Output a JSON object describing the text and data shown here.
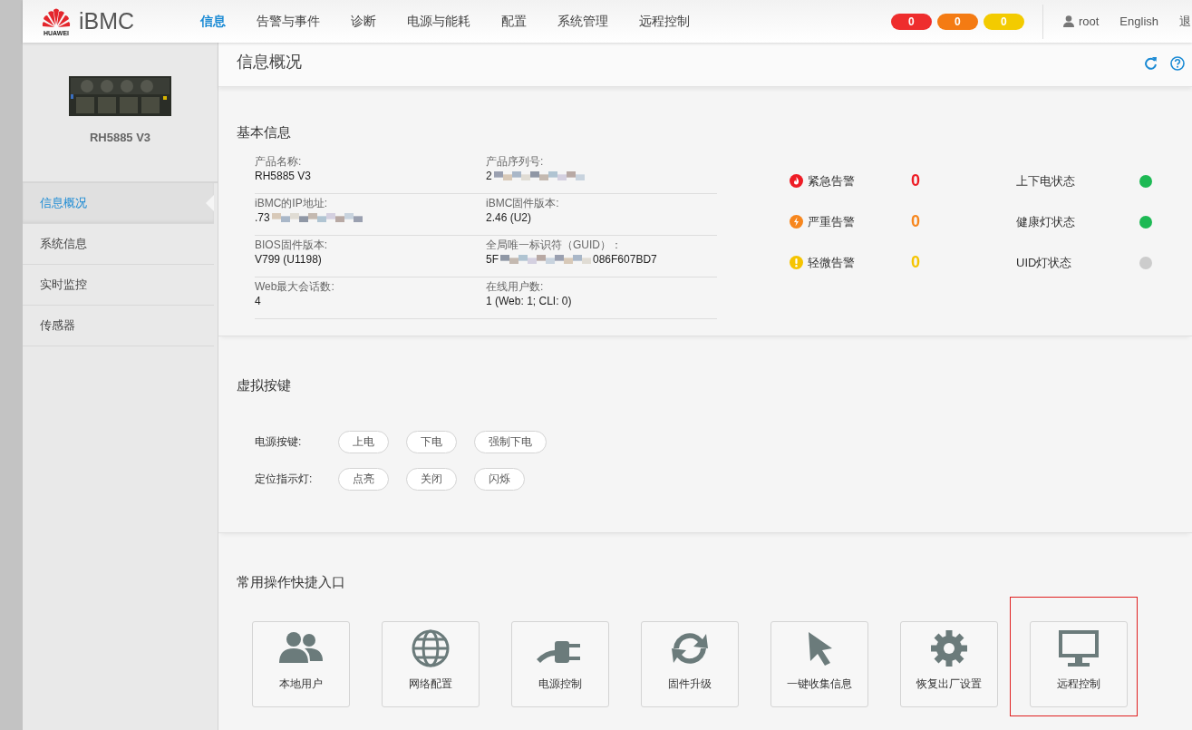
{
  "header": {
    "logo_caption": "HUAWEI",
    "product": "iBMC",
    "nav": [
      {
        "label": "信息",
        "selected": true
      },
      {
        "label": "告警与事件",
        "selected": false
      },
      {
        "label": "诊断",
        "selected": false
      },
      {
        "label": "电源与能耗",
        "selected": false
      },
      {
        "label": "配置",
        "selected": false
      },
      {
        "label": "系统管理",
        "selected": false
      },
      {
        "label": "远程控制",
        "selected": false
      }
    ],
    "alarm_badges": [
      {
        "count": "0",
        "color": "#ee2d2d"
      },
      {
        "count": "0",
        "color": "#f47b13"
      },
      {
        "count": "0",
        "color": "#f3cb00"
      }
    ],
    "user": "root",
    "language": "English",
    "logout": "退"
  },
  "sidebar": {
    "model": "RH5885 V3",
    "items": [
      {
        "label": "信息概况",
        "selected": true
      },
      {
        "label": "系统信息",
        "selected": false
      },
      {
        "label": "实时监控",
        "selected": false
      },
      {
        "label": "传感器",
        "selected": false
      }
    ]
  },
  "page_title": "信息概况",
  "basic_info": {
    "title": "基本信息",
    "fields": [
      {
        "label": "产品名称:",
        "value": "RH5885 V3",
        "redacted": false
      },
      {
        "label": "产品序列号:",
        "value": "2",
        "redacted": true
      },
      {
        "label": "iBMC的IP地址:",
        "value": ".73",
        "redacted": true
      },
      {
        "label": "iBMC固件版本:",
        "value": "2.46 (U2)",
        "redacted": false
      },
      {
        "label": "BIOS固件版本:",
        "value": "V799 (U1198)",
        "redacted": false
      },
      {
        "label": "全局唯一标识符（GUID）：",
        "value": "5F",
        "value_end": "086F607BD7",
        "redacted": true
      },
      {
        "label": "Web最大会话数:",
        "value": "4",
        "redacted": false
      },
      {
        "label": "在线用户数:",
        "value": "1 (Web: 1; CLI: 0)",
        "redacted": false
      }
    ],
    "alarms": [
      {
        "label": "紧急告警",
        "count": "0",
        "color": "#ee1c25"
      },
      {
        "label": "严重告警",
        "count": "0",
        "color": "#f7861d"
      },
      {
        "label": "轻微告警",
        "count": "0",
        "color": "#f5c400"
      }
    ],
    "statuses": [
      {
        "label": "上下电状态",
        "color": "#1db954"
      },
      {
        "label": "健康灯状态",
        "color": "#1db954"
      },
      {
        "label": "UID灯状态",
        "color": "#cccccc"
      }
    ]
  },
  "virtual_buttons": {
    "title": "虚拟按键",
    "rows": [
      {
        "label": "电源按键:",
        "buttons": [
          "上电",
          "下电",
          "强制下电"
        ]
      },
      {
        "label": "定位指示灯:",
        "buttons": [
          "点亮",
          "关闭",
          "闪烁"
        ]
      }
    ]
  },
  "quick_access": {
    "title": "常用操作快捷入口",
    "tiles": [
      {
        "label": "本地用户",
        "highlighted": false
      },
      {
        "label": "网络配置",
        "highlighted": false
      },
      {
        "label": "电源控制",
        "highlighted": false
      },
      {
        "label": "固件升级",
        "highlighted": false
      },
      {
        "label": "一键收集信息",
        "highlighted": false
      },
      {
        "label": "恢复出厂设置",
        "highlighted": false
      },
      {
        "label": "远程控制",
        "highlighted": true
      }
    ]
  }
}
